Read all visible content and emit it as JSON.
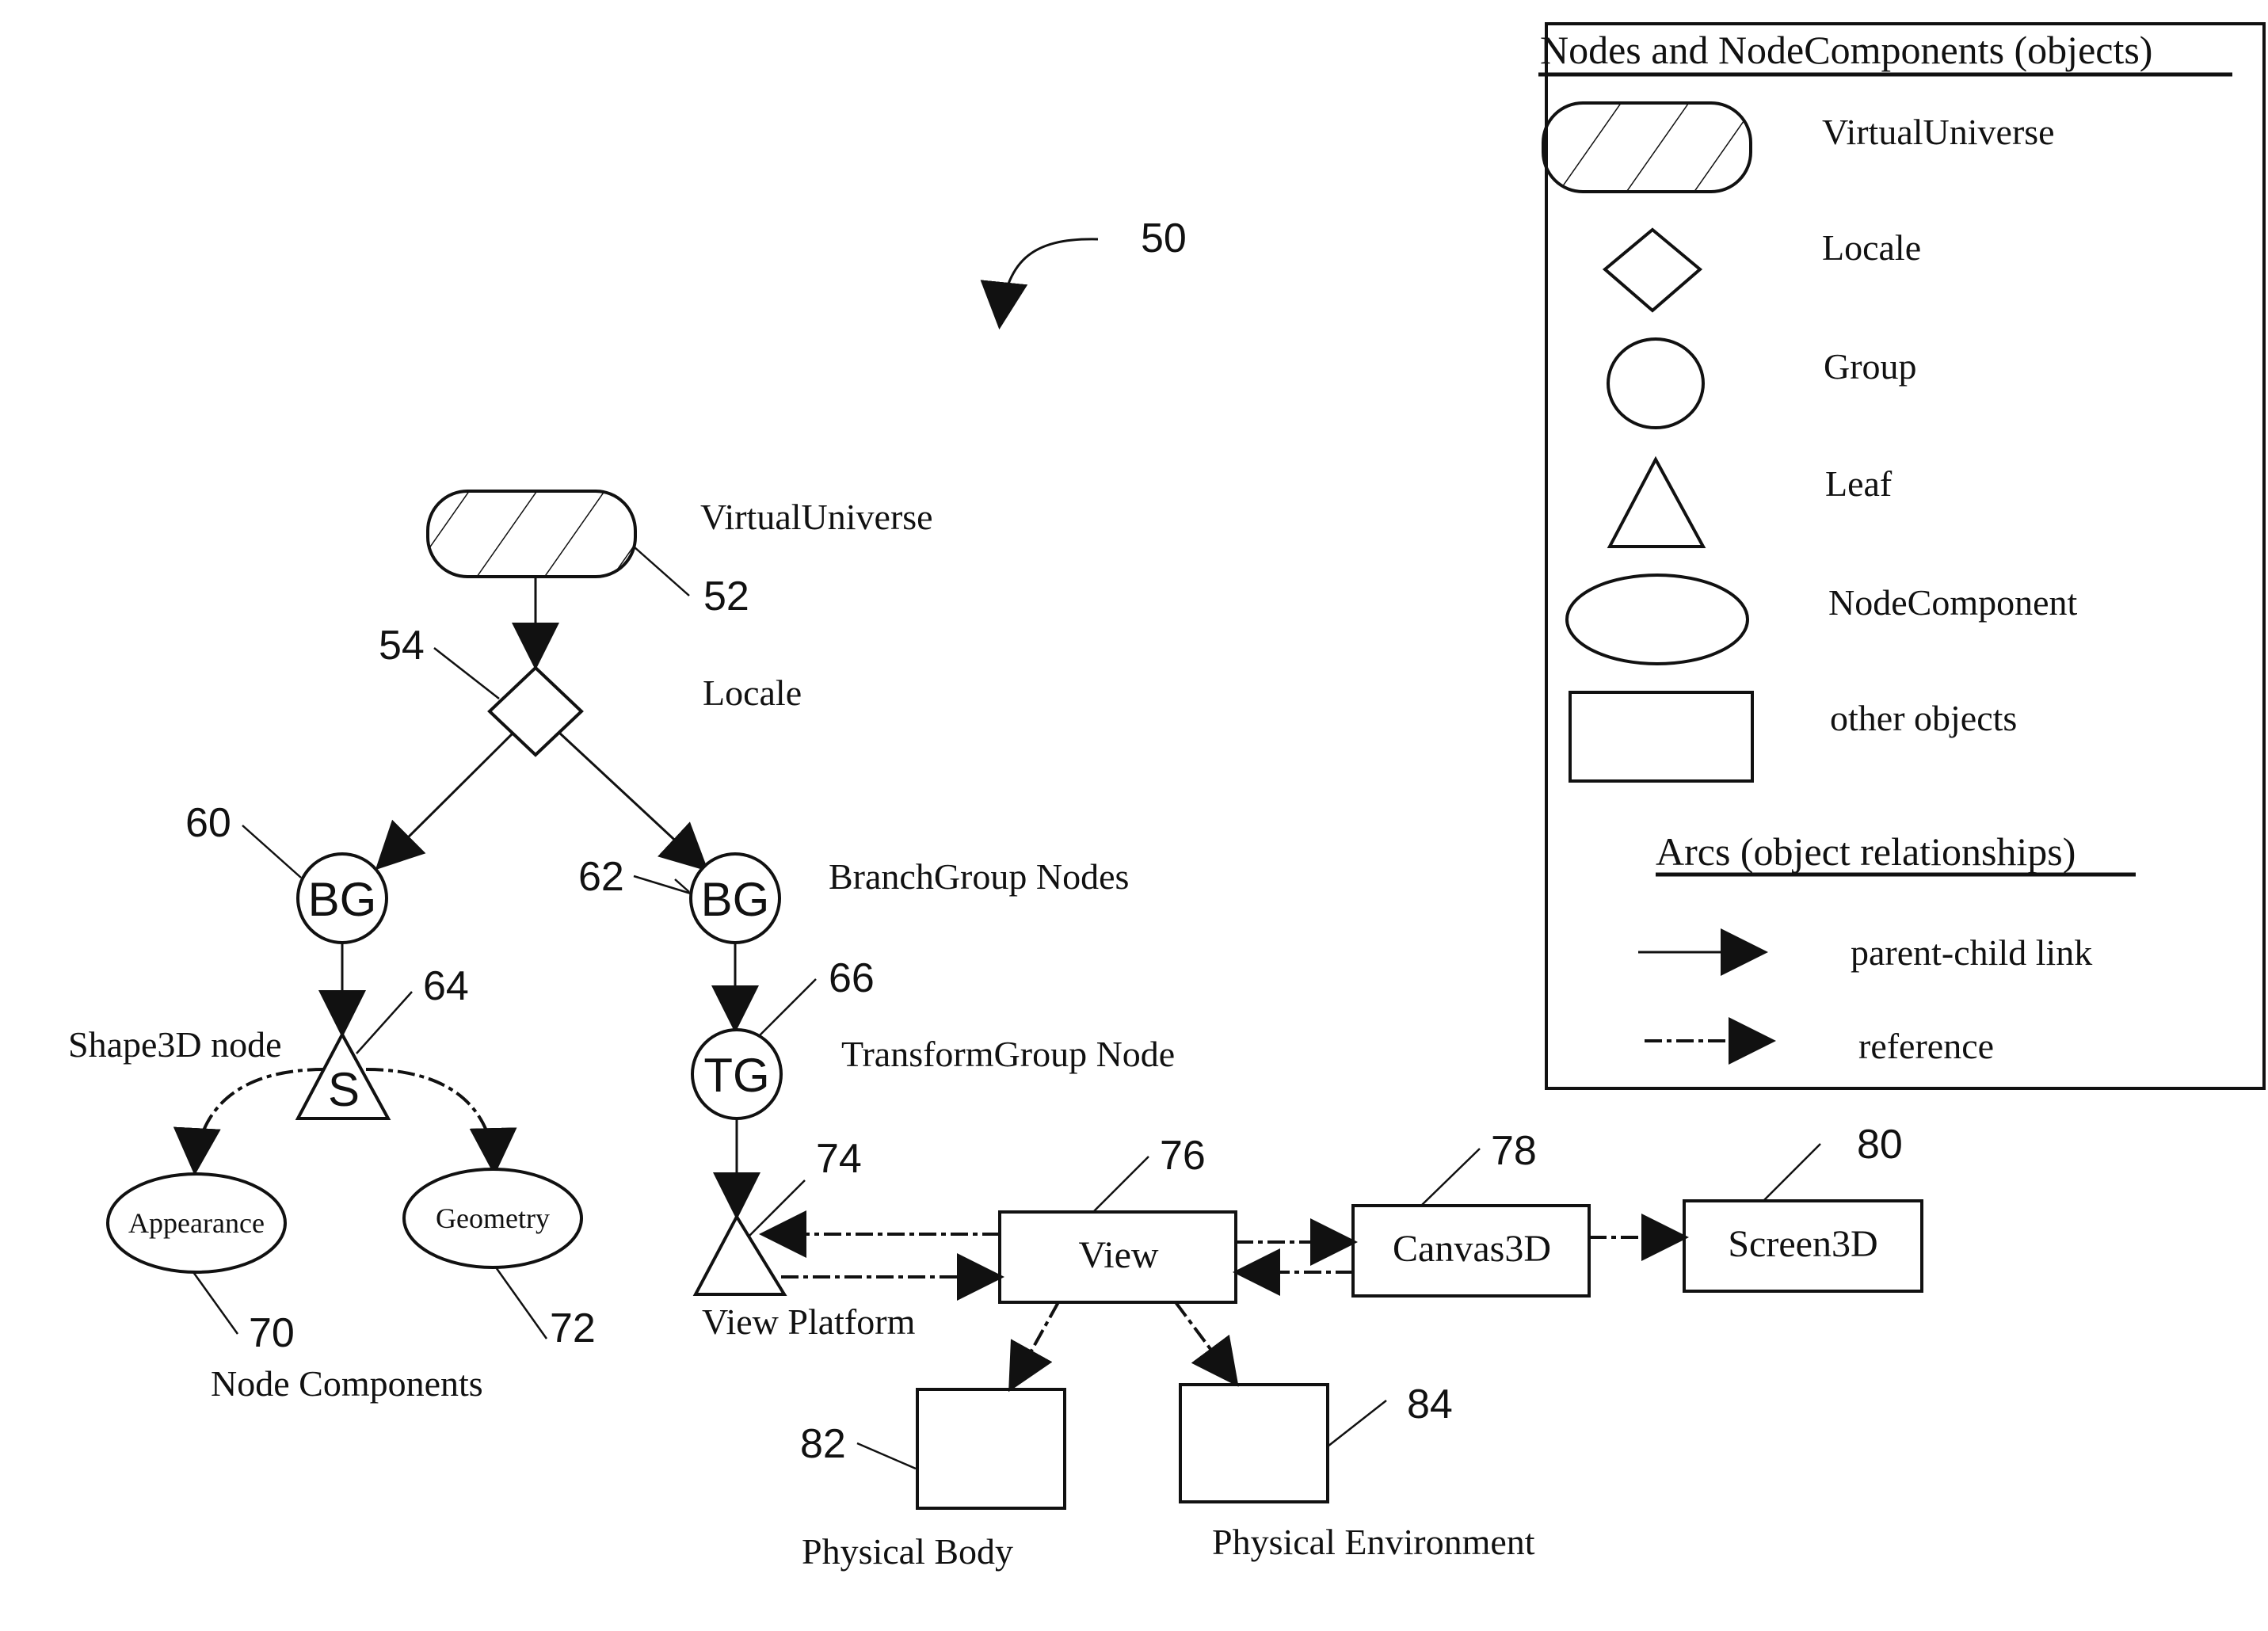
{
  "figure_ref": "50",
  "nodes": {
    "virtual_universe": {
      "label": "VirtualUniverse",
      "ref": "52"
    },
    "locale": {
      "label": "Locale",
      "ref": "54"
    },
    "bg_left": {
      "inner": "BG",
      "ref": "60"
    },
    "bg_right": {
      "inner": "BG",
      "ref": "62"
    },
    "branchgroup_caption": "BranchGroup Nodes",
    "shape3d": {
      "inner": "S",
      "label": "Shape3D node",
      "ref": "64"
    },
    "transform_group": {
      "inner": "TG",
      "label": "TransformGroup Node",
      "ref": "66"
    },
    "appearance": {
      "label": "Appearance",
      "ref": "70"
    },
    "geometry": {
      "label": "Geometry",
      "ref": "72"
    },
    "node_components_caption": "Node Components",
    "view_platform": {
      "label": "View Platform",
      "ref": "74"
    },
    "view": {
      "label": "View",
      "ref": "76"
    },
    "canvas3d": {
      "label": "Canvas3D",
      "ref": "78"
    },
    "screen3d": {
      "label": "Screen3D",
      "ref": "80"
    },
    "physical_body": {
      "label": "Physical Body",
      "ref": "82"
    },
    "physical_environment": {
      "label": "Physical Environment",
      "ref": "84"
    }
  },
  "legend": {
    "title": "Nodes and NodeComponents (objects)",
    "items": [
      {
        "shape": "hatched-rounded-rect",
        "label": "VirtualUniverse"
      },
      {
        "shape": "diamond",
        "label": "Locale"
      },
      {
        "shape": "circle",
        "label": "Group"
      },
      {
        "shape": "triangle",
        "label": "Leaf"
      },
      {
        "shape": "ellipse",
        "label": "NodeComponent"
      },
      {
        "shape": "rectangle",
        "label": "other objects"
      }
    ],
    "arcs_title": "Arcs (object relationships)",
    "arcs": [
      {
        "style": "solid",
        "label": "parent-child link"
      },
      {
        "style": "dashed",
        "label": "reference"
      }
    ]
  }
}
